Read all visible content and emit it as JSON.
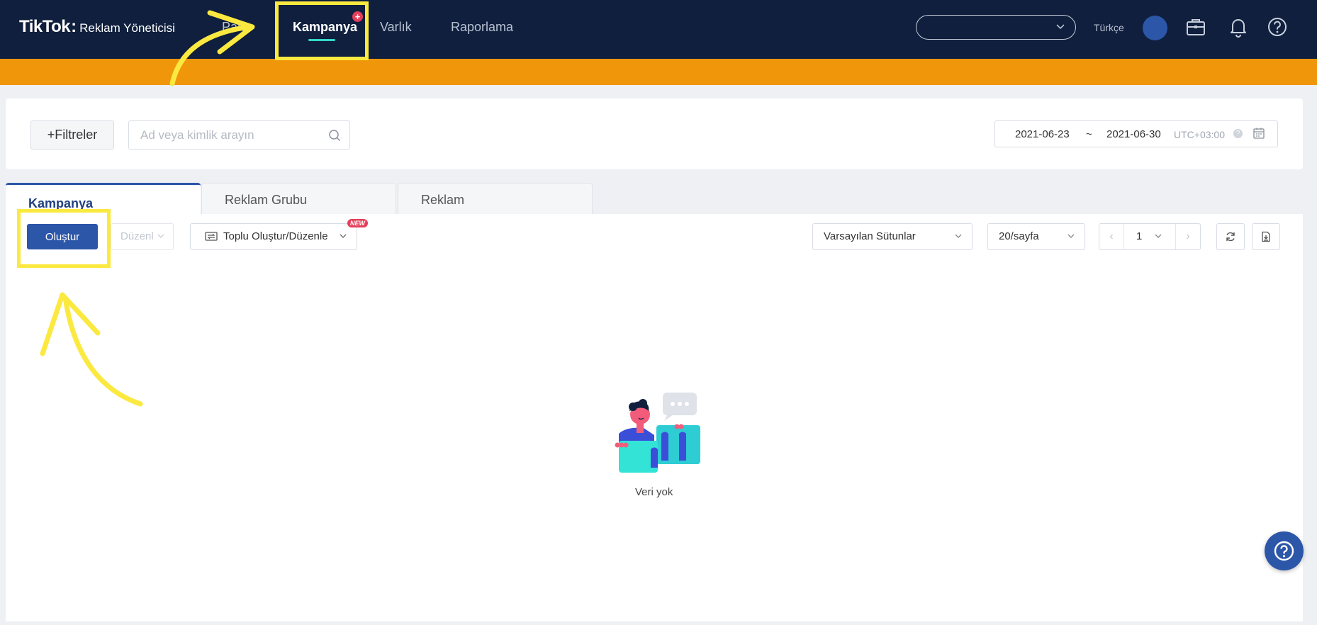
{
  "header": {
    "logo_main": "TikTok",
    "logo_colon": ":",
    "logo_sub": "Reklam Yöneticisi",
    "nav": {
      "dashboard": "Pano",
      "campaign": "Kampanya",
      "assets": "Varlık",
      "reporting": "Raporlama"
    },
    "campaign_plus": "+",
    "language": "Türkçe",
    "account_select_value": "",
    "icons": [
      "briefcase-icon",
      "bell-icon",
      "help-icon"
    ]
  },
  "filters": {
    "add_filters_label": "+Filtreler",
    "search_placeholder": "Ad veya kimlik arayın",
    "search_value": "",
    "date_start": "2021-06-23",
    "date_separator": "~",
    "date_end": "2021-06-30",
    "timezone": "UTC+03:00",
    "tz_help": "?"
  },
  "tabs": {
    "campaign": "Kampanya",
    "ad_group": "Reklam Grubu",
    "ad": "Reklam"
  },
  "toolbar": {
    "create_label": "Oluştur",
    "edit_label": "Düzenl",
    "bulk_label": "Toplu Oluştur/Düzenle",
    "new_badge": "NEW",
    "columns_value": "Varsayılan Sütunlar",
    "page_size_value": "20/sayfa",
    "page_number": "1",
    "prev": "‹",
    "next": "›"
  },
  "empty_state": {
    "text": "Veri yok"
  },
  "colors": {
    "nav_bg": "#0f1f3d",
    "orange_bar": "#f0960a",
    "primary": "#2c56a8",
    "highlight": "#fbe940",
    "accent_teal": "#33d6c8",
    "badge_red": "#e53f5a"
  }
}
